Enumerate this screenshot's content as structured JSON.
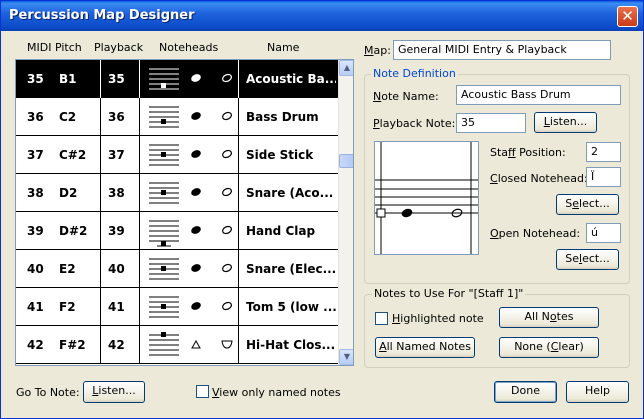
{
  "window": {
    "title": "Percussion Map Designer",
    "close_glyph": "✕"
  },
  "columns": {
    "midi": "MIDI Pitch",
    "playback": "Playback",
    "noteheads": "Noteheads",
    "name": "Name"
  },
  "rows": [
    {
      "num": "35",
      "pitch": "B1",
      "playback": "35",
      "name": "Acoustic Ba...",
      "selected": true
    },
    {
      "num": "36",
      "pitch": "C2",
      "playback": "36",
      "name": "Bass Drum"
    },
    {
      "num": "37",
      "pitch": "C#2",
      "playback": "37",
      "name": "Side Stick"
    },
    {
      "num": "38",
      "pitch": "D2",
      "playback": "38",
      "name": "Snare (Aco..."
    },
    {
      "num": "39",
      "pitch": "D#2",
      "playback": "39",
      "name": "Hand Clap"
    },
    {
      "num": "40",
      "pitch": "E2",
      "playback": "40",
      "name": "Snare (Elec..."
    },
    {
      "num": "41",
      "pitch": "F2",
      "playback": "41",
      "name": "Tom 5 (low ..."
    },
    {
      "num": "42",
      "pitch": "F#2",
      "playback": "42",
      "name": "Hi-Hat Clos..."
    }
  ],
  "map": {
    "label": "Map:",
    "value": "General MIDI Entry & Playback"
  },
  "note_definition": {
    "title": "Note Definition",
    "note_name_label": "Note Name:",
    "note_name_value": "Acoustic Bass Drum",
    "playback_label": "Playback Note:",
    "playback_value": "35",
    "listen_label": "Listen...",
    "staff_position_label": "Staff Position:",
    "staff_position_value": "2",
    "closed_label": "Closed Notehead:",
    "closed_value": "Ï",
    "select_label": "Select...",
    "open_label": "Open Notehead:",
    "open_value": "ú"
  },
  "notes_to_use": {
    "title": "Notes to Use For \"[Staff 1]\"",
    "highlighted": "Highlighted note",
    "all_notes": "All Notes",
    "all_named": "All Named Notes",
    "none_clear": "None (Clear)"
  },
  "footer": {
    "goto_label": "Go To Note:",
    "listen_label": "Listen...",
    "view_only": "View only named notes",
    "done": "Done",
    "help": "Help"
  }
}
